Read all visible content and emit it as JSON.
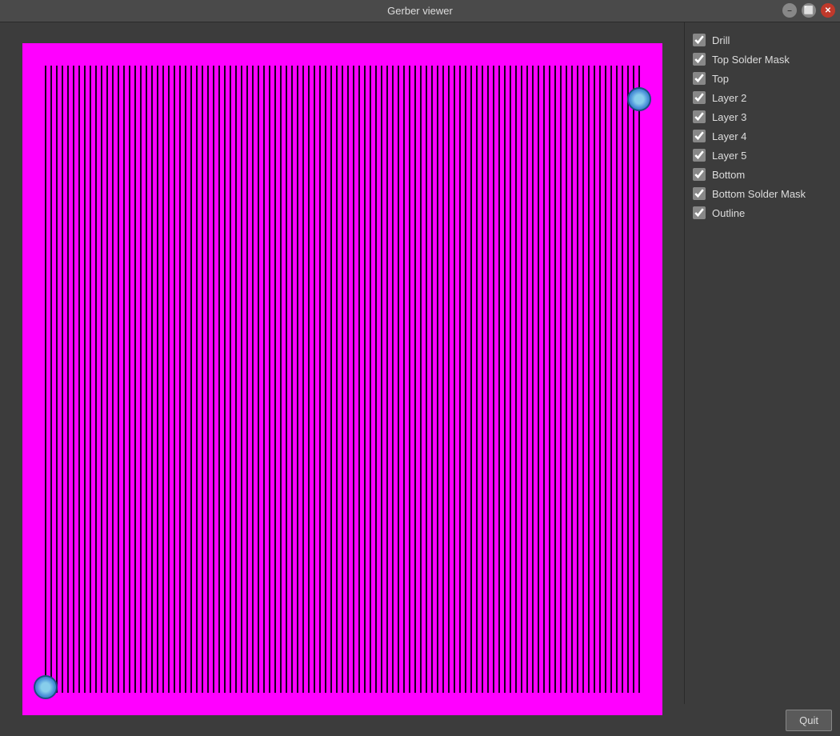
{
  "titlebar": {
    "title": "Gerber viewer",
    "minimize_label": "–",
    "restore_label": "⬜",
    "close_label": "✕"
  },
  "sidebar": {
    "layers": [
      {
        "id": "drill",
        "label": "Drill",
        "checked": true
      },
      {
        "id": "top-solder-mask",
        "label": "Top Solder Mask",
        "checked": true
      },
      {
        "id": "top",
        "label": "Top",
        "checked": true
      },
      {
        "id": "layer2",
        "label": "Layer 2",
        "checked": true
      },
      {
        "id": "layer3",
        "label": "Layer 3",
        "checked": true
      },
      {
        "id": "layer4",
        "label": "Layer 4",
        "checked": true
      },
      {
        "id": "layer5",
        "label": "Layer 5",
        "checked": true
      },
      {
        "id": "bottom",
        "label": "Bottom",
        "checked": true
      },
      {
        "id": "bottom-solder-mask",
        "label": "Bottom Solder Mask",
        "checked": true
      },
      {
        "id": "outline",
        "label": "Outline",
        "checked": true
      }
    ]
  },
  "toolbar": {
    "quit_label": "Quit"
  }
}
